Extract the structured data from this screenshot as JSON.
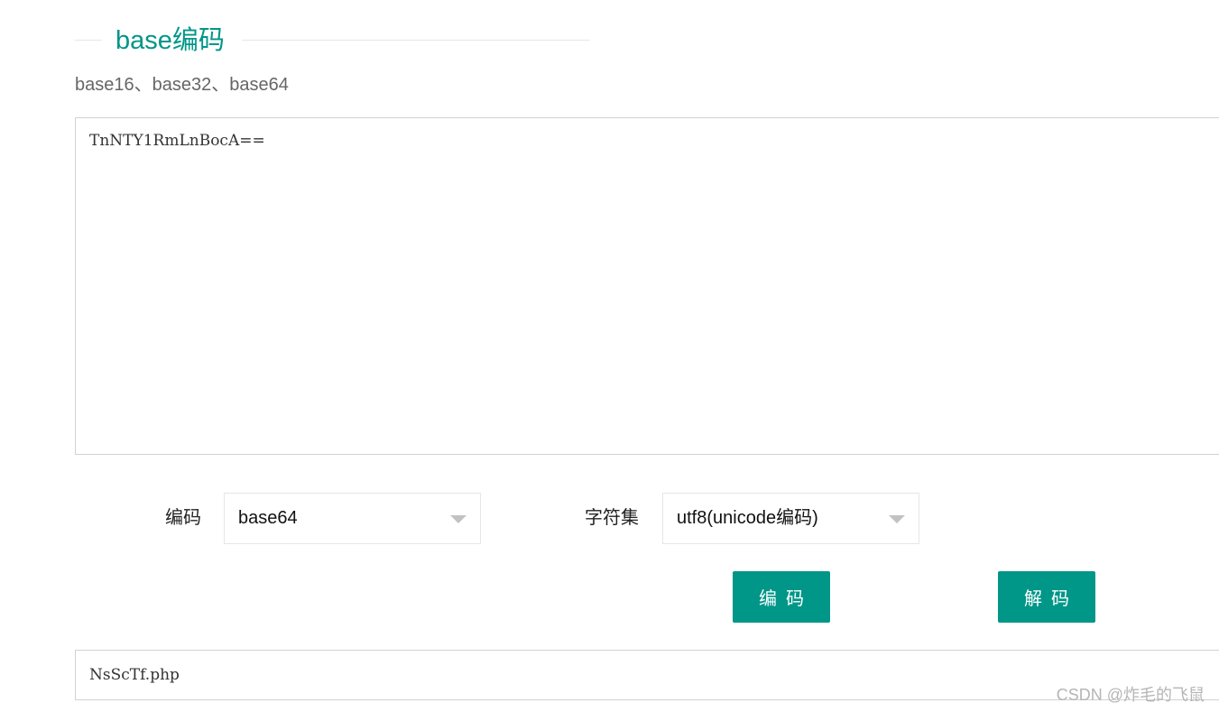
{
  "section": {
    "title": "base编码",
    "subtitle": "base16、base32、base64"
  },
  "input": {
    "value": "TnNTY1RmLnBocA=="
  },
  "controls": {
    "encoding_label": "编码",
    "encoding_value": "base64",
    "charset_label": "字符集",
    "charset_value": "utf8(unicode编码)"
  },
  "buttons": {
    "encode_label": "编码",
    "decode_label": "解码"
  },
  "output": {
    "value": "NsScTf.php"
  },
  "watermark": {
    "text": "CSDN @炸毛的飞鼠"
  },
  "colors": {
    "accent": "#009688",
    "border": "#d2d2d2",
    "subtitle": "#666666"
  }
}
